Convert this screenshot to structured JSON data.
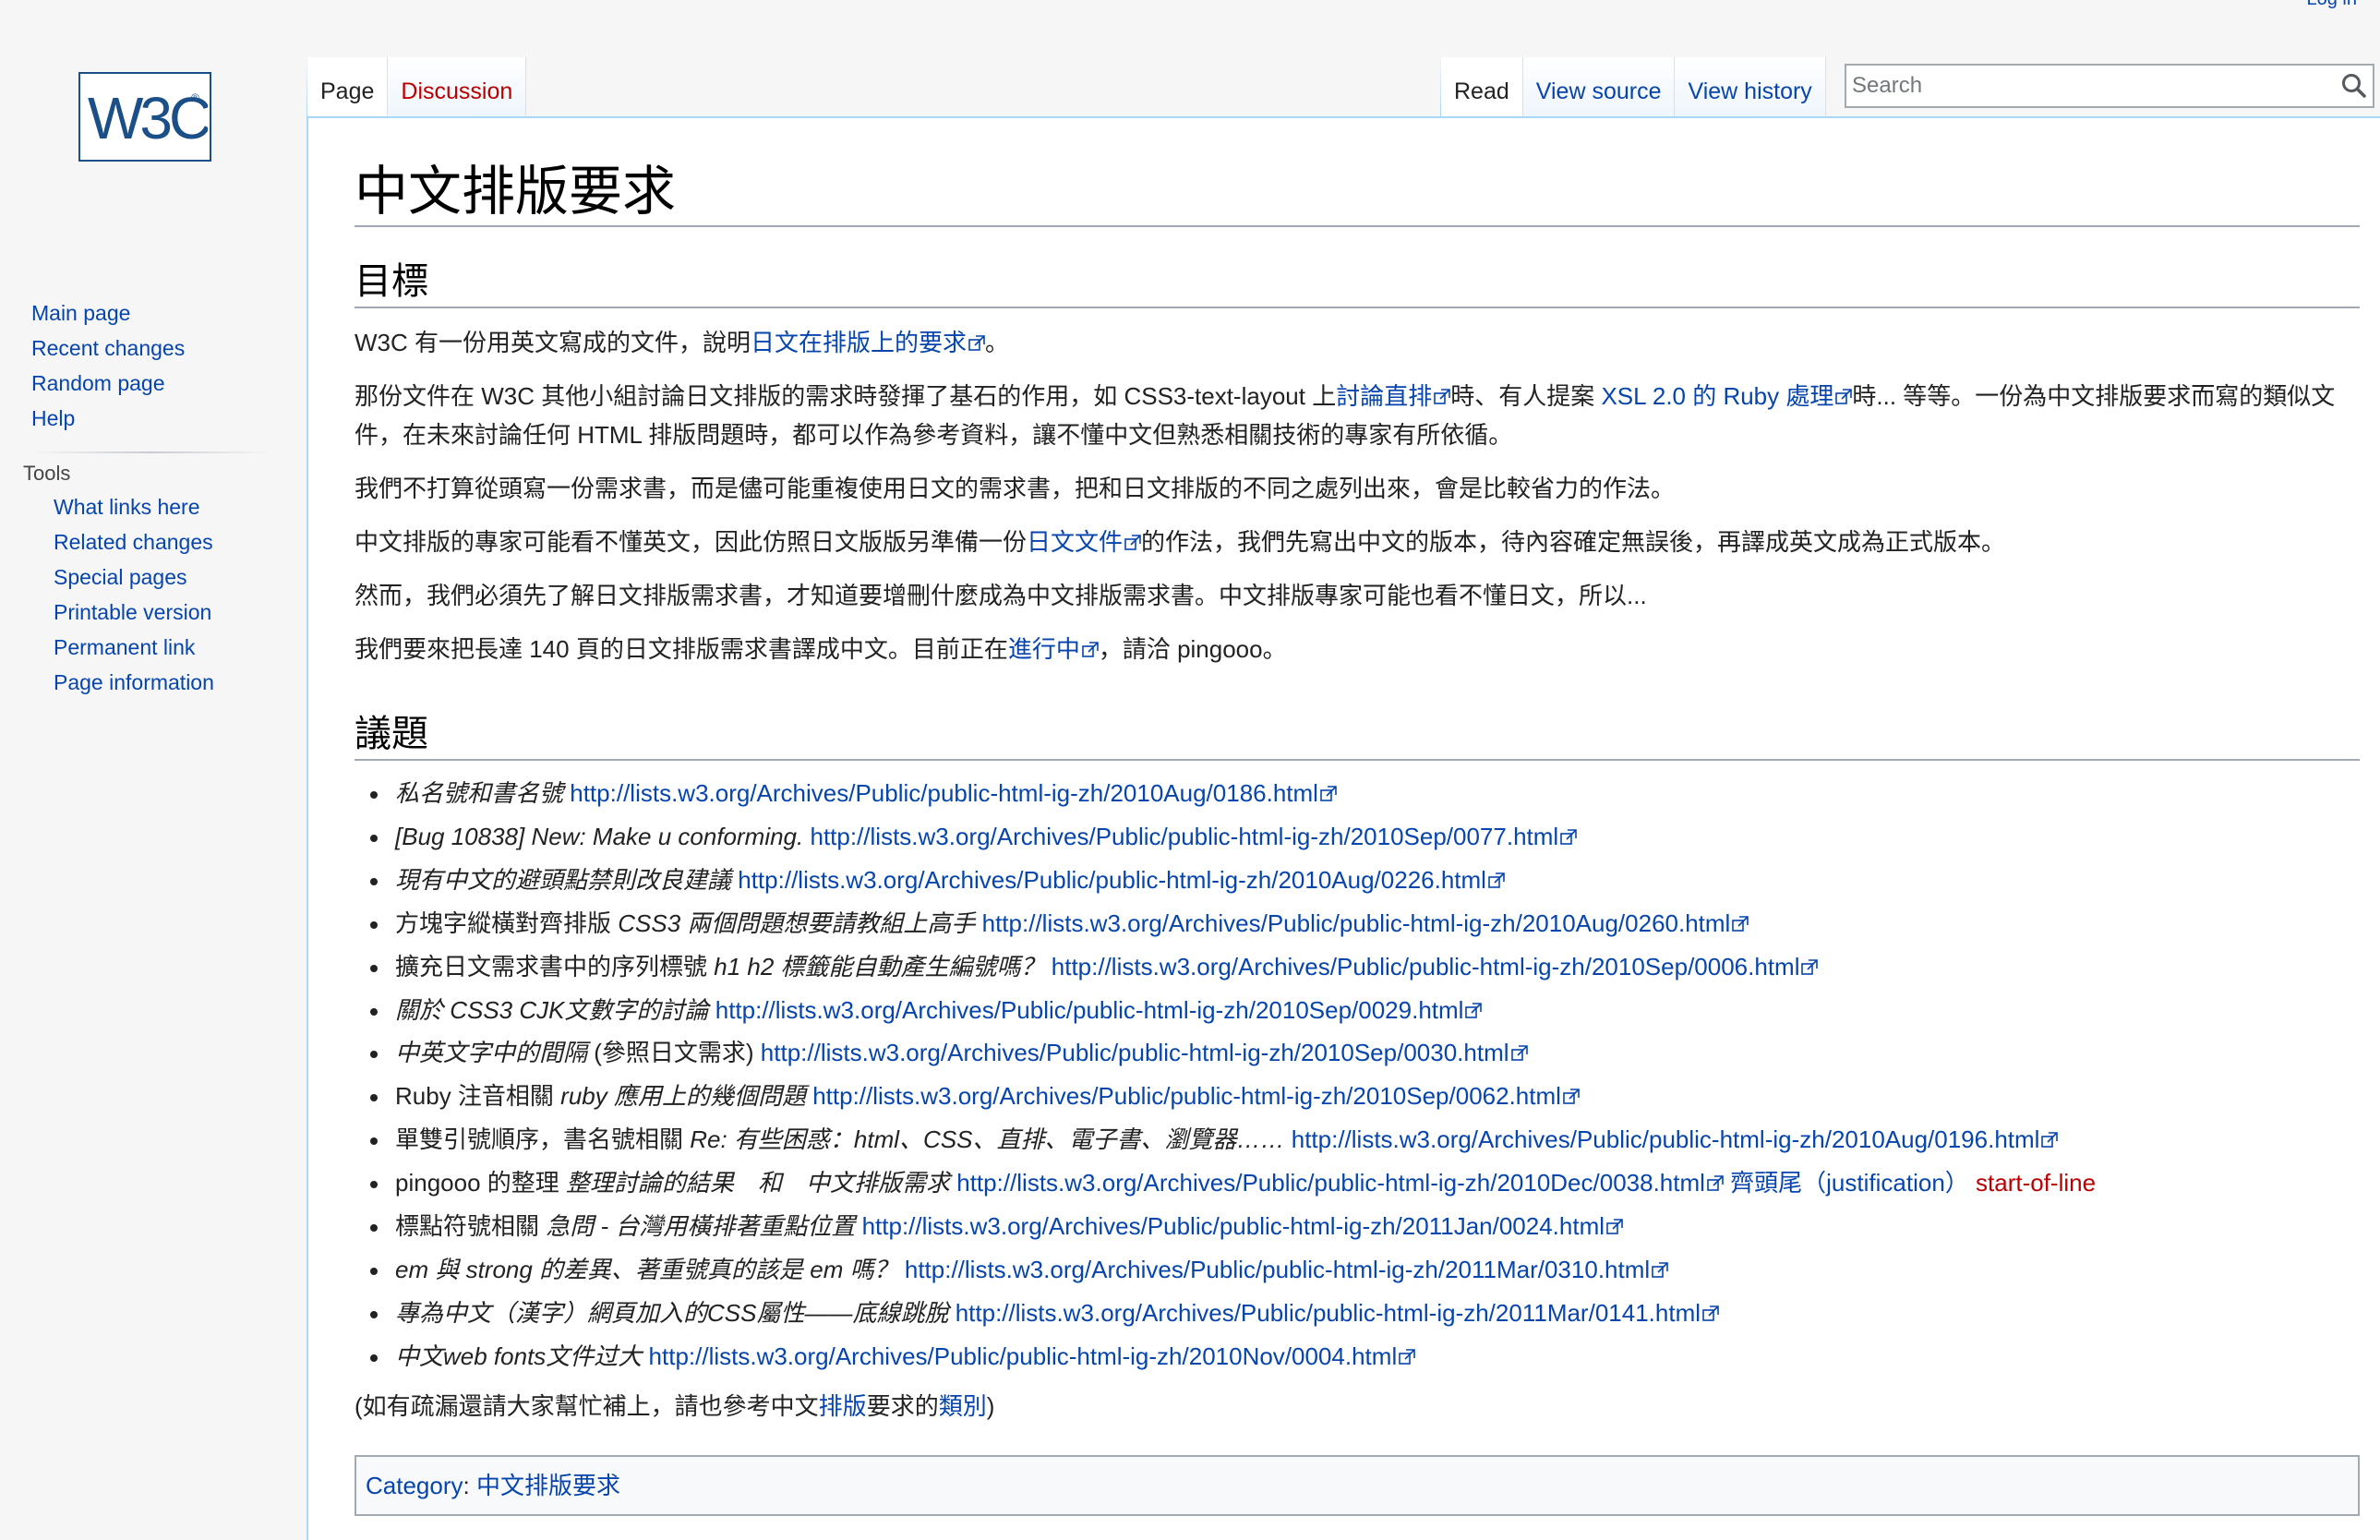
{
  "personal": {
    "login": "Log in"
  },
  "logo": {
    "text": "W3C",
    "mark": "®"
  },
  "sidebar": {
    "nav": [
      "Main page",
      "Recent changes",
      "Random page",
      "Help"
    ],
    "tools_heading": "Tools",
    "tools": [
      "What links here",
      "Related changes",
      "Special pages",
      "Printable version",
      "Permanent link",
      "Page information"
    ]
  },
  "tabs": {
    "page": "Page",
    "discussion": "Discussion",
    "read": "Read",
    "view_source": "View source",
    "view_history": "View history"
  },
  "search": {
    "placeholder": "Search"
  },
  "title": "中文排版要求",
  "sections": {
    "goal": "目標",
    "issues": "議題"
  },
  "paragraphs": {
    "p1a": "W3C 有一份用英文寫成的文件，說明",
    "p1link": "日文在排版上的要求",
    "p1b": "。",
    "p2a": "那份文件在 W3C 其他小組討論日文排版的需求時發揮了基石的作用，如 CSS3-text-layout 上",
    "p2link1": "討論直排",
    "p2b": "時、有人提案 ",
    "p2link2": "XSL 2.0 的 Ruby 處理",
    "p2c": "時... 等等。一份為中文排版要求而寫的類似文件，在未來討論任何 HTML 排版問題時，都可以作為參考資料，讓不懂中文但熟悉相關技術的專家有所依循。",
    "p3": "我們不打算從頭寫一份需求書，而是儘可能重複使用日文的需求書，把和日文排版的不同之處列出來，會是比較省力的作法。",
    "p4a": "中文排版的專家可能看不懂英文，因此仿照日文版版另準備一份",
    "p4link": "日文文件",
    "p4b": "的作法，我們先寫出中文的版本，待內容確定無誤後，再譯成英文成為正式版本。",
    "p5": "然而，我們必須先了解日文排版需求書，才知道要增刪什麼成為中文排版需求書。中文排版專家可能也看不懂日文，所以...",
    "p6a": "我們要來把長達 140 頁的日文排版需求書譯成中文。目前正在",
    "p6link": "進行中",
    "p6b": "，請洽 pingooo。"
  },
  "issues": [
    {
      "pre": "",
      "em": "私名號和書名號",
      "url": "http://lists.w3.org/Archives/Public/public-html-ig-zh/2010Aug/0186.html"
    },
    {
      "pre": "",
      "em": "[Bug 10838] New: Make u conforming.",
      "url": "http://lists.w3.org/Archives/Public/public-html-ig-zh/2010Sep/0077.html"
    },
    {
      "pre": "",
      "em": "現有中文的避頭點禁則改良建議",
      "url": "http://lists.w3.org/Archives/Public/public-html-ig-zh/2010Aug/0226.html"
    },
    {
      "pre": "方塊字縱橫對齊排版 ",
      "em": "CSS3 兩個問題想要請教組上高手",
      "url": "http://lists.w3.org/Archives/Public/public-html-ig-zh/2010Aug/0260.html"
    },
    {
      "pre": "擴充日文需求書中的序列標號 ",
      "em": "h1 h2 標籤能自動產生編號嗎？",
      "url": "http://lists.w3.org/Archives/Public/public-html-ig-zh/2010Sep/0006.html"
    },
    {
      "pre": "",
      "em": "關於 CSS3 CJK文數字的討論",
      "url": "http://lists.w3.org/Archives/Public/public-html-ig-zh/2010Sep/0029.html"
    },
    {
      "pre": "",
      "em": "中英文字中的間隔",
      "post": " (參照日文需求)",
      "url": "http://lists.w3.org/Archives/Public/public-html-ig-zh/2010Sep/0030.html"
    },
    {
      "pre": "Ruby 注音相關 ",
      "em": "ruby 應用上的幾個問題",
      "url": "http://lists.w3.org/Archives/Public/public-html-ig-zh/2010Sep/0062.html"
    },
    {
      "pre": "單雙引號順序，書名號相關 ",
      "em": "Re: 有些困惑：html、CSS、直排、電子書、瀏覽器……",
      "url": "http://lists.w3.org/Archives/Public/public-html-ig-zh/2010Aug/0196.html"
    },
    {
      "pre": "pingooo 的整理 ",
      "em": "整理討論的結果　和　中文排版需求",
      "url": "http://lists.w3.org/Archives/Public/public-html-ig-zh/2010Dec/0038.html",
      "extra1": "齊頭尾（justification）",
      "extra2": "start-of-line"
    },
    {
      "pre": "標點符號相關 ",
      "em": "急問 - 台灣用橫排著重點位置",
      "url": "http://lists.w3.org/Archives/Public/public-html-ig-zh/2011Jan/0024.html"
    },
    {
      "pre": "",
      "em": "em 與 strong 的差異、著重號真的該是 em 嗎？",
      "url": "http://lists.w3.org/Archives/Public/public-html-ig-zh/2011Mar/0310.html"
    },
    {
      "pre": "",
      "em": "專為中文（漢字）網頁加入的CSS屬性——底線跳脫",
      "url": "http://lists.w3.org/Archives/Public/public-html-ig-zh/2011Mar/0141.html"
    },
    {
      "pre": "",
      "em": "中文web fonts文件过大",
      "url": "http://lists.w3.org/Archives/Public/public-html-ig-zh/2010Nov/0004.html"
    }
  ],
  "footer_note": {
    "a": "(如有疏漏還請大家幫忙補上，請也參考中文",
    "link1": "排版",
    "b": "要求的",
    "link2": "類別",
    "c": ")"
  },
  "category": {
    "label": "Category",
    "sep": ": ",
    "value": "中文排版要求"
  },
  "colors": {
    "link": "#0645ad",
    "redlink": "#ba0000",
    "border": "#a7d7f9"
  }
}
